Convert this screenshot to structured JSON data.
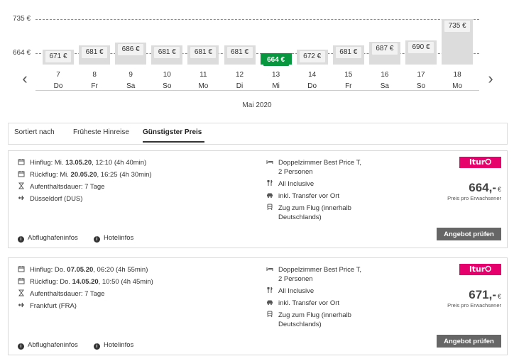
{
  "calendar": {
    "ref_high": "735 €",
    "ref_low": "664 €",
    "month": "Mai 2020",
    "max_value": 735,
    "min_value": 664,
    "days": [
      {
        "num": "7",
        "name": "Do",
        "price": "671 €",
        "value": 671
      },
      {
        "num": "8",
        "name": "Fr",
        "price": "681 €",
        "value": 681
      },
      {
        "num": "9",
        "name": "Sa",
        "price": "686 €",
        "value": 686
      },
      {
        "num": "10",
        "name": "So",
        "price": "681 €",
        "value": 681
      },
      {
        "num": "11",
        "name": "Mo",
        "price": "681 €",
        "value": 681
      },
      {
        "num": "12",
        "name": "Di",
        "price": "681 €",
        "value": 681
      },
      {
        "num": "13",
        "name": "Mi",
        "price": "664 €",
        "value": 664,
        "selected": true
      },
      {
        "num": "14",
        "name": "Do",
        "price": "672 €",
        "value": 672
      },
      {
        "num": "15",
        "name": "Fr",
        "price": "681 €",
        "value": 681
      },
      {
        "num": "16",
        "name": "Sa",
        "price": "687 €",
        "value": 687
      },
      {
        "num": "17",
        "name": "So",
        "price": "690 €",
        "value": 690
      },
      {
        "num": "18",
        "name": "Mo",
        "price": "735 €",
        "value": 735
      }
    ]
  },
  "sort": {
    "label": "Sortiert nach",
    "options": [
      "Früheste Hinreise",
      "Günstigster Preis"
    ],
    "active": "Günstigster Preis"
  },
  "offers": [
    {
      "hinflug_prefix": "Hinflug: Mi. ",
      "hinflug_date": "13.05.20",
      "hinflug_rest": ", 12:10 (4h 40min)",
      "rueckflug_prefix": "Rückflug: Mi. ",
      "rueckflug_date": "20.05.20",
      "rueckflug_rest": ", 16:25 (4h 30min)",
      "stay": "Aufenthaltsdauer: 7 Tage",
      "airport": "Düsseldorf (DUS)",
      "room": "Doppelzimmer Best Price T,",
      "persons": "2 Personen",
      "board": "All Inclusive",
      "transfer": "inkl. Transfer vor Ort",
      "train": "Zug zum Flug (innerhalb",
      "train2": "Deutschlands)",
      "operator": "ltur",
      "price": "664,-",
      "currency": "€",
      "price_note": "Preis pro Erwachsener",
      "cta": "Angebot prüfen",
      "airport_info": "Abflughafeninfos",
      "hotel_info": "Hotelinfos"
    },
    {
      "hinflug_prefix": "Hinflug: Do. ",
      "hinflug_date": "07.05.20",
      "hinflug_rest": ", 06:20 (4h 55min)",
      "rueckflug_prefix": "Rückflug: Do. ",
      "rueckflug_date": "14.05.20",
      "rueckflug_rest": ", 10:50 (4h 45min)",
      "stay": "Aufenthaltsdauer: 7 Tage",
      "airport": "Frankfurt (FRA)",
      "room": "Doppelzimmer Best Price T,",
      "persons": "2 Personen",
      "board": "All Inclusive",
      "transfer": "inkl. Transfer vor Ort",
      "train": "Zug zum Flug (innerhalb",
      "train2": "Deutschlands)",
      "operator": "ltur",
      "price": "671,-",
      "currency": "€",
      "price_note": "Preis pro Erwachsener",
      "cta": "Angebot prüfen",
      "airport_info": "Abflughafeninfos",
      "hotel_info": "Hotelinfos"
    }
  ],
  "colors": {
    "selected": "#06973f",
    "brand": "#e5006d",
    "button": "#666666"
  }
}
